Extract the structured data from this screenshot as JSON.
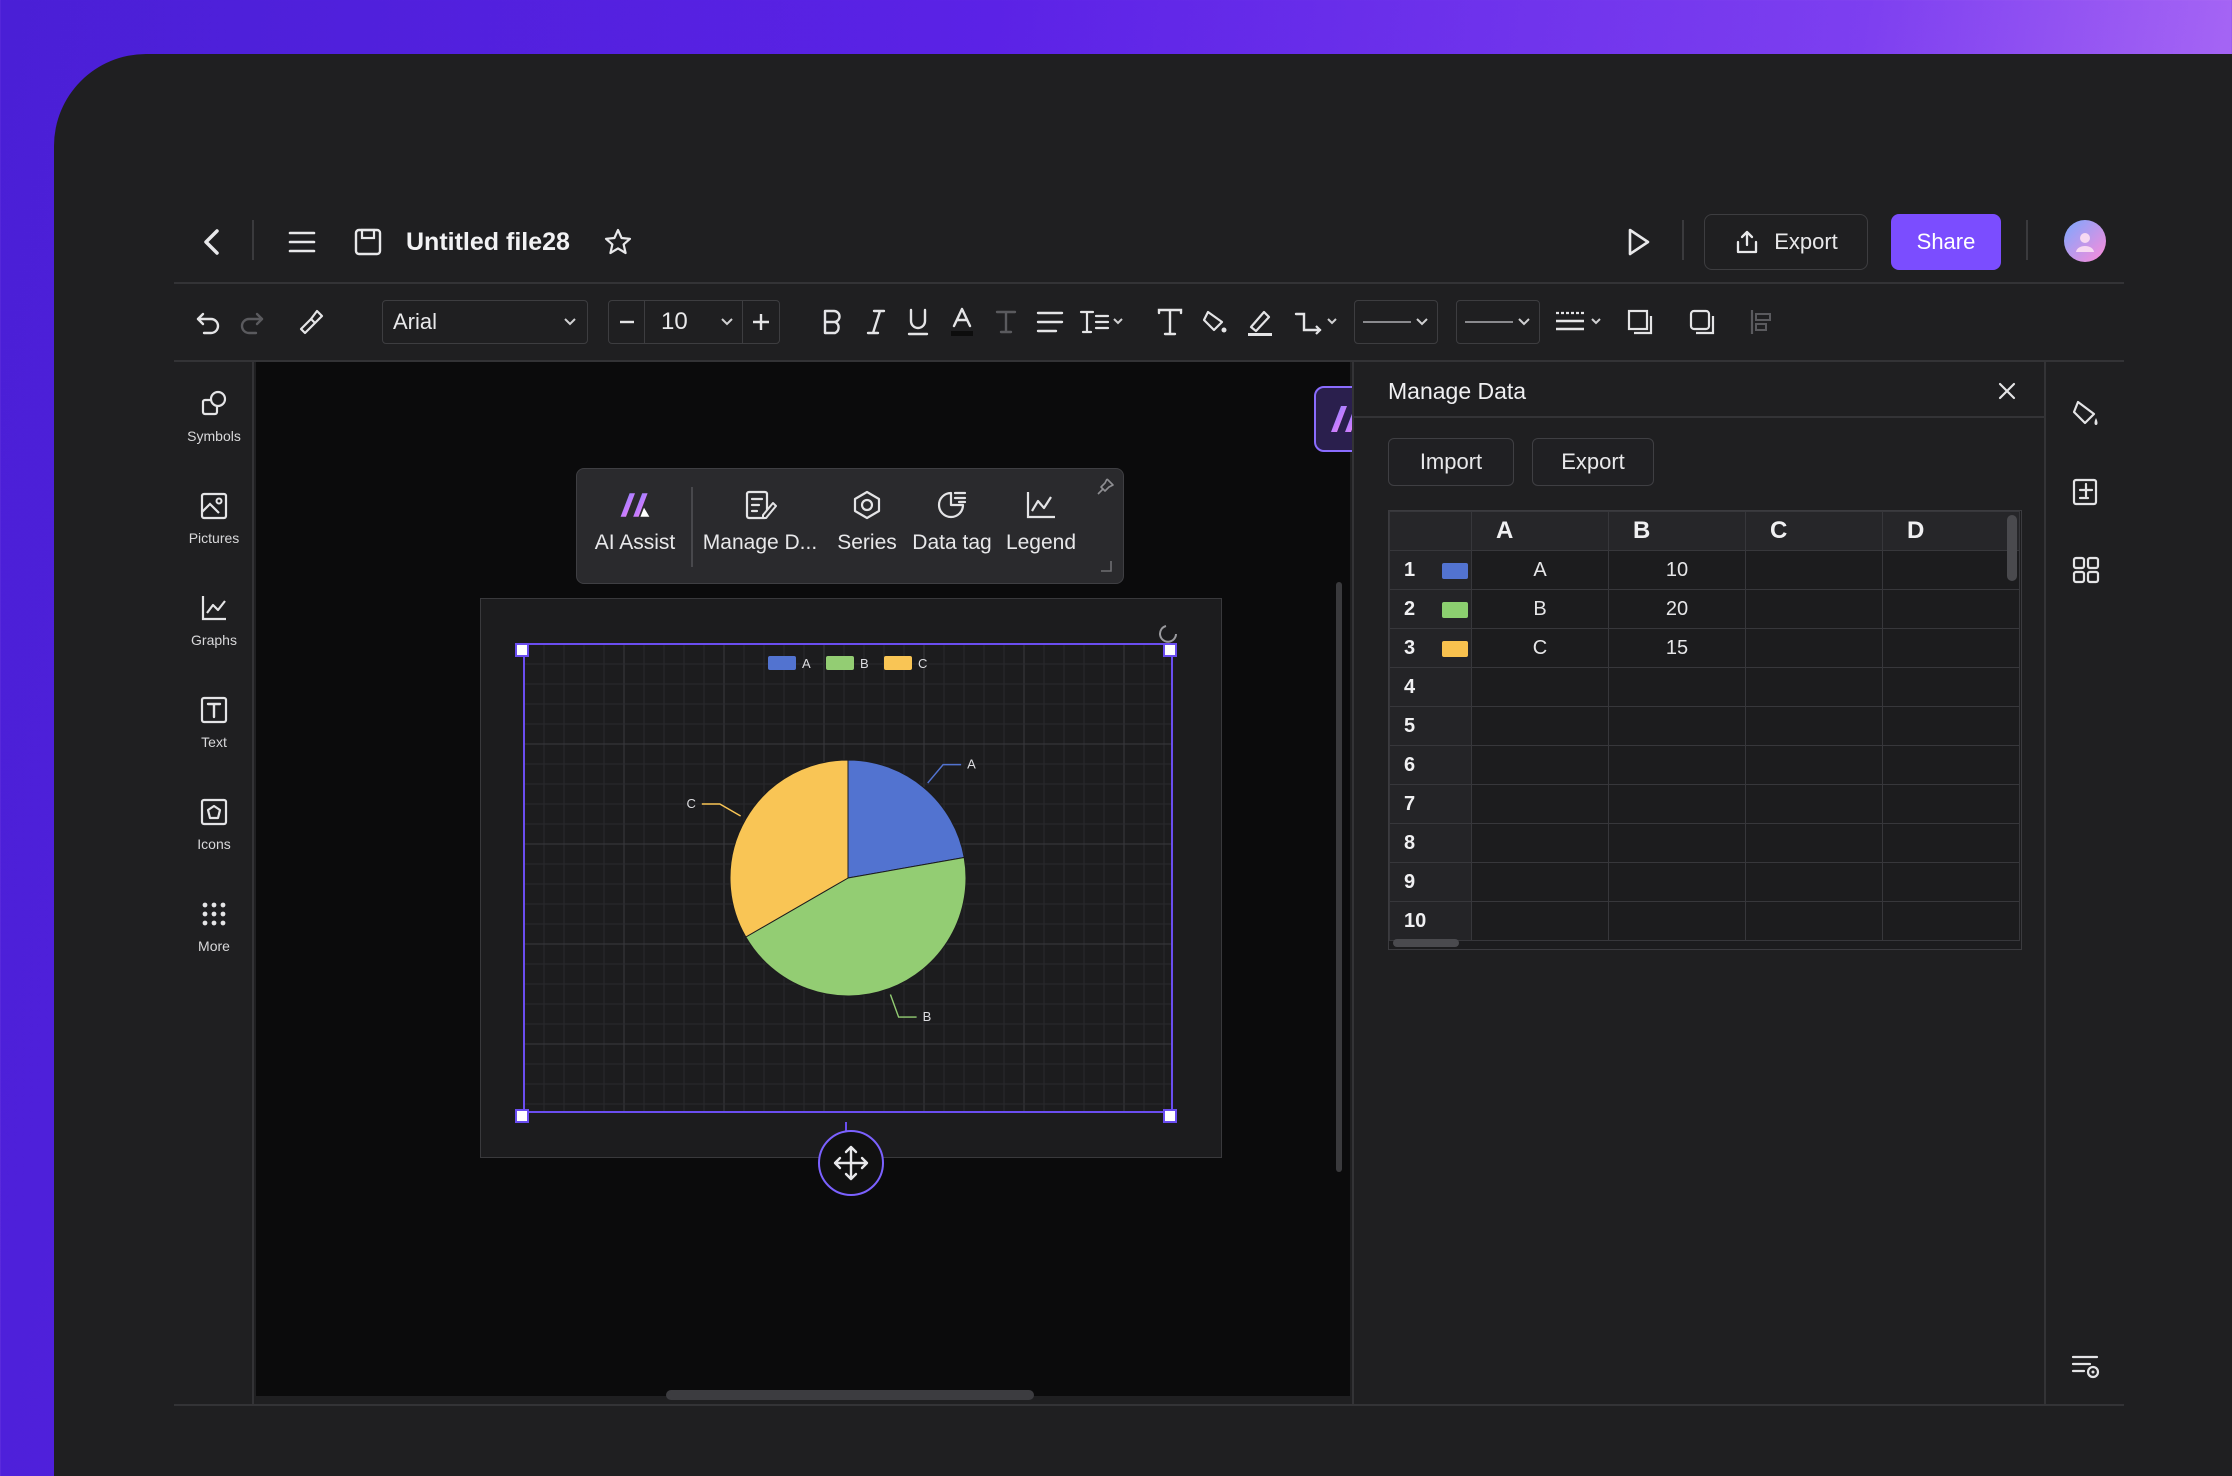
{
  "window": {
    "file_title": "Untitled file28",
    "export_label": "Export",
    "share_label": "Share"
  },
  "toolbar": {
    "font": "Arial",
    "font_size": "10"
  },
  "sidebar": {
    "items": [
      {
        "label": "Symbols",
        "icon": "symbols-icon"
      },
      {
        "label": "Pictures",
        "icon": "pictures-icon"
      },
      {
        "label": "Graphs",
        "icon": "graphs-icon"
      },
      {
        "label": "Text",
        "icon": "text-icon"
      },
      {
        "label": "Icons",
        "icon": "icons-icon"
      },
      {
        "label": "More",
        "icon": "more-icon"
      }
    ]
  },
  "context_bar": {
    "items": [
      {
        "label": "AI Assist",
        "icon": "ai-assist-icon"
      },
      {
        "label": "Manage D...",
        "icon": "manage-data-icon"
      },
      {
        "label": "Series",
        "icon": "series-icon"
      },
      {
        "label": "Data tag",
        "icon": "data-tag-icon"
      },
      {
        "label": "Legend",
        "icon": "legend-icon"
      }
    ]
  },
  "panel": {
    "title": "Manage Data",
    "import_label": "Import",
    "export_label": "Export",
    "columns": [
      "A",
      "B",
      "C",
      "D"
    ],
    "rows": [
      {
        "num": "1",
        "color": "#5273d0",
        "a": "A",
        "b": "10",
        "c": "",
        "d": ""
      },
      {
        "num": "2",
        "color": "#8ccf70",
        "a": "B",
        "b": "20",
        "c": "",
        "d": ""
      },
      {
        "num": "3",
        "color": "#f8c14e",
        "a": "C",
        "b": "15",
        "c": "",
        "d": ""
      },
      {
        "num": "4",
        "color": "",
        "a": "",
        "b": "",
        "c": "",
        "d": ""
      },
      {
        "num": "5",
        "color": "",
        "a": "",
        "b": "",
        "c": "",
        "d": ""
      },
      {
        "num": "6",
        "color": "",
        "a": "",
        "b": "",
        "c": "",
        "d": ""
      },
      {
        "num": "7",
        "color": "",
        "a": "",
        "b": "",
        "c": "",
        "d": ""
      },
      {
        "num": "8",
        "color": "",
        "a": "",
        "b": "",
        "c": "",
        "d": ""
      },
      {
        "num": "9",
        "color": "",
        "a": "",
        "b": "",
        "c": "",
        "d": ""
      },
      {
        "num": "10",
        "color": "",
        "a": "",
        "b": "",
        "c": "",
        "d": ""
      }
    ]
  },
  "chart_data": {
    "type": "pie",
    "categories": [
      "A",
      "B",
      "C"
    ],
    "values": [
      10,
      20,
      15
    ],
    "colors": [
      "#5273d0",
      "#93cd73",
      "#f9c555"
    ],
    "legend": [
      "A",
      "B",
      "C"
    ],
    "legend_position": "top-center",
    "grid": true
  },
  "colors": {
    "accent": "#7b4dff",
    "selection": "#6a4df0"
  }
}
